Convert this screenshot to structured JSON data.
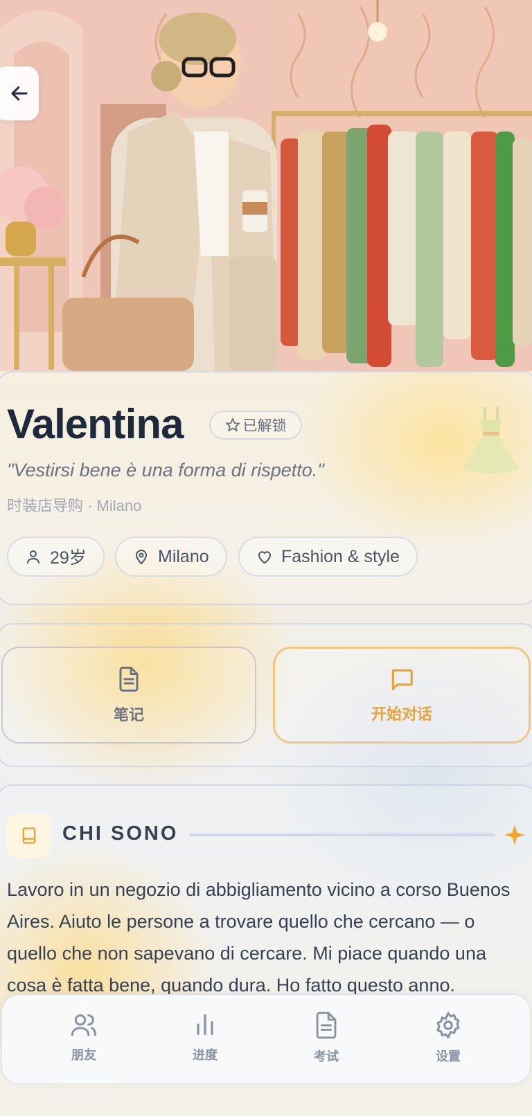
{
  "profile": {
    "name": "Valentina",
    "unlock_badge": "已解锁",
    "quote": "\"Vestirsi bene è una forma di rispetto.\"",
    "subtitle": "时装店导购 · Milano",
    "chips": [
      {
        "icon": "person-icon",
        "label": "29岁"
      },
      {
        "icon": "map-pin-icon",
        "label": "Milano"
      },
      {
        "icon": "heart-icon",
        "label": "Fashion & style"
      }
    ]
  },
  "actions": {
    "notes_label": "笔记",
    "chat_label": "开始对话"
  },
  "about": {
    "title": "CHI SONO",
    "text": "Lavoro in un negozio di abbigliamento vicino a corso Buenos Aires. Aiuto le persone a trovare quello che cercano — o quello che non sapevano di cercare. Mi piace quando una cosa è fatta bene, quando dura. Ho fatto questo anno."
  },
  "nav": {
    "items": [
      {
        "icon": "friends-icon",
        "label": "朋友"
      },
      {
        "icon": "progress-icon",
        "label": "进度"
      },
      {
        "icon": "exam-icon",
        "label": "考试"
      },
      {
        "icon": "settings-icon",
        "label": "设置"
      }
    ]
  },
  "colors": {
    "accent": "#e7a339",
    "title": "#1e2a3b",
    "muted": "#8a93a3"
  }
}
